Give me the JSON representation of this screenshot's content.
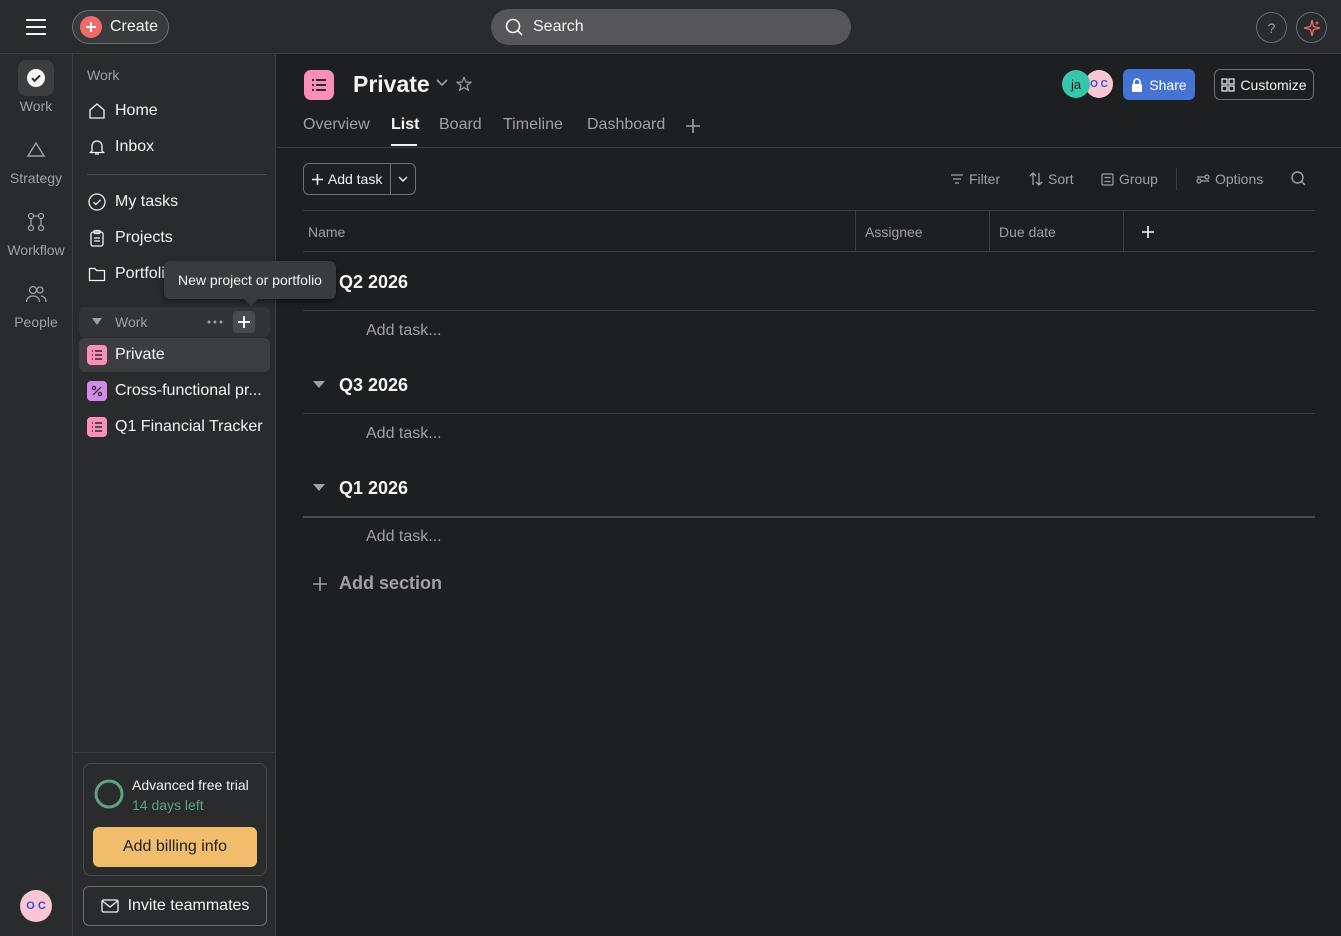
{
  "topbar": {
    "create_label": "Create",
    "search_label": "Search",
    "help_label": "?"
  },
  "rail": {
    "items": [
      {
        "label": "Work"
      },
      {
        "label": "Strategy"
      },
      {
        "label": "Workflow"
      },
      {
        "label": "People"
      }
    ],
    "avatar_initials": "O C"
  },
  "sidebar": {
    "heading": "Work",
    "home": "Home",
    "inbox": "Inbox",
    "my_tasks": "My tasks",
    "projects": "Projects",
    "portfolios": "Portfoli",
    "team_section": "Work",
    "project_items": [
      {
        "label": "Private"
      },
      {
        "label": "Cross-functional pr..."
      },
      {
        "label": "Q1 Financial Tracker"
      }
    ],
    "trial_title": "Advanced free trial",
    "trial_days": "14 days left",
    "billing_label": "Add billing info",
    "invite_label": "Invite teammates"
  },
  "tooltip": {
    "text": "New project or portfolio"
  },
  "project": {
    "title": "Private",
    "tabs": [
      "Overview",
      "List",
      "Board",
      "Timeline",
      "Dashboard"
    ],
    "active_tab": "List",
    "share_label": "Share",
    "customize_label": "Customize",
    "avatars": [
      {
        "initials": "ja",
        "color": "#37c5ab"
      },
      {
        "initials": "O C",
        "color": "#f8c7d4"
      }
    ]
  },
  "toolbar": {
    "add_task": "Add task",
    "filter": "Filter",
    "sort": "Sort",
    "group": "Group",
    "options": "Options"
  },
  "table": {
    "columns": [
      "Name",
      "Assignee",
      "Due date"
    ]
  },
  "sections": [
    {
      "title": "Q2 2026",
      "add_task": "Add task..."
    },
    {
      "title": "Q3 2026",
      "add_task": "Add task..."
    },
    {
      "title": "Q1 2026",
      "add_task": "Add task..."
    }
  ],
  "add_section_label": "Add section",
  "colors": {
    "accent": "#4573d2",
    "create": "#f06a6a",
    "project_pink": "#fc8fb7",
    "project_purple": "#d28be8",
    "billing": "#f1bd6c",
    "trial_ring": "#5da283"
  }
}
